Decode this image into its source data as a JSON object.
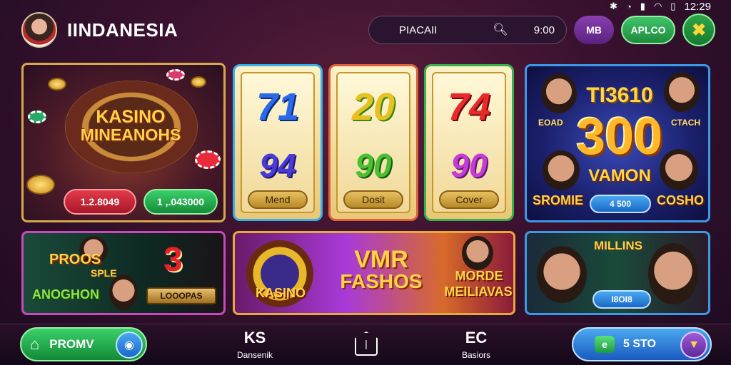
{
  "status_bar": {
    "time": "12:29",
    "icons": [
      "bluetooth-icon",
      "alarm-icon",
      "signal-icon",
      "wifi-icon",
      "battery-icon"
    ]
  },
  "header": {
    "brand": "IINDANESIA",
    "search": {
      "label": "PIACAII",
      "time": "9:00"
    },
    "chip_mb": "MB",
    "chip_apl": "APLCO",
    "chip_x": "✖"
  },
  "cards": {
    "kasino": {
      "title_line1": "KASINO",
      "title_line2": "MINEANOHS",
      "btn_red": "1.2.8049",
      "btn_green": "1 ,.043000"
    },
    "slots": [
      {
        "n1": "71",
        "n2": "94",
        "label": "Mend"
      },
      {
        "n1": "20",
        "n2": "90",
        "label": "Dosit"
      },
      {
        "n1": "74",
        "n2": "90",
        "label": "Cover"
      }
    ],
    "jackpot": {
      "top": "TI3610",
      "big": "300",
      "sub": "VAMON",
      "btn": "4 500",
      "tag_left": "EOAD",
      "tag_right": "CTACH",
      "side_left": "SROMIE",
      "side_right": "COSHO"
    },
    "pros": {
      "t1": "PROOS",
      "t2": "SPLE",
      "t3": "ANOGHON",
      "num": "3",
      "btn": "LOOOPAS"
    },
    "vmr": {
      "kasino": "KASINO",
      "t1": "VMR",
      "t2": "FASHOS",
      "r1": "MORDE",
      "r2": "MEILIAVAS"
    },
    "millions": {
      "title": "MILLINS",
      "btn": "I8OI8"
    }
  },
  "navbar": {
    "home_label": "PROMV",
    "item1": {
      "icon": "KS",
      "label": "Dansenik"
    },
    "center_icon": "|",
    "item2": {
      "icon": "EC",
      "label": "Basiors"
    },
    "bonus_label": "5 STO",
    "bonus_icon": "e"
  },
  "colors": {
    "accent_gold": "#ffd34a",
    "accent_green": "#3ad06a",
    "accent_blue": "#4aa8f0",
    "card_border_gold": "#d9a84a"
  }
}
